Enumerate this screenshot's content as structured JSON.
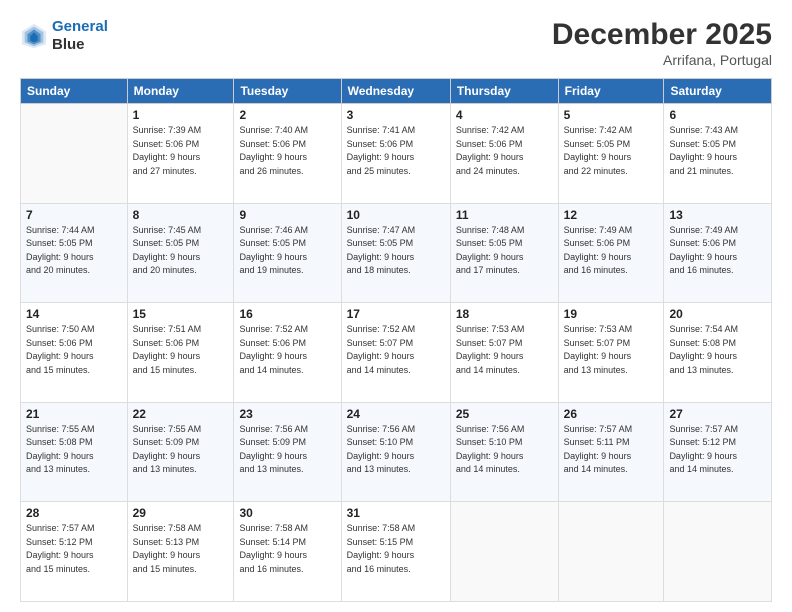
{
  "header": {
    "logo_line1": "General",
    "logo_line2": "Blue",
    "month": "December 2025",
    "location": "Arrifana, Portugal"
  },
  "weekdays": [
    "Sunday",
    "Monday",
    "Tuesday",
    "Wednesday",
    "Thursday",
    "Friday",
    "Saturday"
  ],
  "weeks": [
    [
      {
        "day": "",
        "sunrise": "",
        "sunset": "",
        "daylight": ""
      },
      {
        "day": "1",
        "sunrise": "Sunrise: 7:39 AM",
        "sunset": "Sunset: 5:06 PM",
        "daylight": "Daylight: 9 hours and 27 minutes."
      },
      {
        "day": "2",
        "sunrise": "Sunrise: 7:40 AM",
        "sunset": "Sunset: 5:06 PM",
        "daylight": "Daylight: 9 hours and 26 minutes."
      },
      {
        "day": "3",
        "sunrise": "Sunrise: 7:41 AM",
        "sunset": "Sunset: 5:06 PM",
        "daylight": "Daylight: 9 hours and 25 minutes."
      },
      {
        "day": "4",
        "sunrise": "Sunrise: 7:42 AM",
        "sunset": "Sunset: 5:06 PM",
        "daylight": "Daylight: 9 hours and 24 minutes."
      },
      {
        "day": "5",
        "sunrise": "Sunrise: 7:42 AM",
        "sunset": "Sunset: 5:05 PM",
        "daylight": "Daylight: 9 hours and 22 minutes."
      },
      {
        "day": "6",
        "sunrise": "Sunrise: 7:43 AM",
        "sunset": "Sunset: 5:05 PM",
        "daylight": "Daylight: 9 hours and 21 minutes."
      }
    ],
    [
      {
        "day": "7",
        "sunrise": "Sunrise: 7:44 AM",
        "sunset": "Sunset: 5:05 PM",
        "daylight": "Daylight: 9 hours and 20 minutes."
      },
      {
        "day": "8",
        "sunrise": "Sunrise: 7:45 AM",
        "sunset": "Sunset: 5:05 PM",
        "daylight": "Daylight: 9 hours and 20 minutes."
      },
      {
        "day": "9",
        "sunrise": "Sunrise: 7:46 AM",
        "sunset": "Sunset: 5:05 PM",
        "daylight": "Daylight: 9 hours and 19 minutes."
      },
      {
        "day": "10",
        "sunrise": "Sunrise: 7:47 AM",
        "sunset": "Sunset: 5:05 PM",
        "daylight": "Daylight: 9 hours and 18 minutes."
      },
      {
        "day": "11",
        "sunrise": "Sunrise: 7:48 AM",
        "sunset": "Sunset: 5:05 PM",
        "daylight": "Daylight: 9 hours and 17 minutes."
      },
      {
        "day": "12",
        "sunrise": "Sunrise: 7:49 AM",
        "sunset": "Sunset: 5:06 PM",
        "daylight": "Daylight: 9 hours and 16 minutes."
      },
      {
        "day": "13",
        "sunrise": "Sunrise: 7:49 AM",
        "sunset": "Sunset: 5:06 PM",
        "daylight": "Daylight: 9 hours and 16 minutes."
      }
    ],
    [
      {
        "day": "14",
        "sunrise": "Sunrise: 7:50 AM",
        "sunset": "Sunset: 5:06 PM",
        "daylight": "Daylight: 9 hours and 15 minutes."
      },
      {
        "day": "15",
        "sunrise": "Sunrise: 7:51 AM",
        "sunset": "Sunset: 5:06 PM",
        "daylight": "Daylight: 9 hours and 15 minutes."
      },
      {
        "day": "16",
        "sunrise": "Sunrise: 7:52 AM",
        "sunset": "Sunset: 5:06 PM",
        "daylight": "Daylight: 9 hours and 14 minutes."
      },
      {
        "day": "17",
        "sunrise": "Sunrise: 7:52 AM",
        "sunset": "Sunset: 5:07 PM",
        "daylight": "Daylight: 9 hours and 14 minutes."
      },
      {
        "day": "18",
        "sunrise": "Sunrise: 7:53 AM",
        "sunset": "Sunset: 5:07 PM",
        "daylight": "Daylight: 9 hours and 14 minutes."
      },
      {
        "day": "19",
        "sunrise": "Sunrise: 7:53 AM",
        "sunset": "Sunset: 5:07 PM",
        "daylight": "Daylight: 9 hours and 13 minutes."
      },
      {
        "day": "20",
        "sunrise": "Sunrise: 7:54 AM",
        "sunset": "Sunset: 5:08 PM",
        "daylight": "Daylight: 9 hours and 13 minutes."
      }
    ],
    [
      {
        "day": "21",
        "sunrise": "Sunrise: 7:55 AM",
        "sunset": "Sunset: 5:08 PM",
        "daylight": "Daylight: 9 hours and 13 minutes."
      },
      {
        "day": "22",
        "sunrise": "Sunrise: 7:55 AM",
        "sunset": "Sunset: 5:09 PM",
        "daylight": "Daylight: 9 hours and 13 minutes."
      },
      {
        "day": "23",
        "sunrise": "Sunrise: 7:56 AM",
        "sunset": "Sunset: 5:09 PM",
        "daylight": "Daylight: 9 hours and 13 minutes."
      },
      {
        "day": "24",
        "sunrise": "Sunrise: 7:56 AM",
        "sunset": "Sunset: 5:10 PM",
        "daylight": "Daylight: 9 hours and 13 minutes."
      },
      {
        "day": "25",
        "sunrise": "Sunrise: 7:56 AM",
        "sunset": "Sunset: 5:10 PM",
        "daylight": "Daylight: 9 hours and 14 minutes."
      },
      {
        "day": "26",
        "sunrise": "Sunrise: 7:57 AM",
        "sunset": "Sunset: 5:11 PM",
        "daylight": "Daylight: 9 hours and 14 minutes."
      },
      {
        "day": "27",
        "sunrise": "Sunrise: 7:57 AM",
        "sunset": "Sunset: 5:12 PM",
        "daylight": "Daylight: 9 hours and 14 minutes."
      }
    ],
    [
      {
        "day": "28",
        "sunrise": "Sunrise: 7:57 AM",
        "sunset": "Sunset: 5:12 PM",
        "daylight": "Daylight: 9 hours and 15 minutes."
      },
      {
        "day": "29",
        "sunrise": "Sunrise: 7:58 AM",
        "sunset": "Sunset: 5:13 PM",
        "daylight": "Daylight: 9 hours and 15 minutes."
      },
      {
        "day": "30",
        "sunrise": "Sunrise: 7:58 AM",
        "sunset": "Sunset: 5:14 PM",
        "daylight": "Daylight: 9 hours and 16 minutes."
      },
      {
        "day": "31",
        "sunrise": "Sunrise: 7:58 AM",
        "sunset": "Sunset: 5:15 PM",
        "daylight": "Daylight: 9 hours and 16 minutes."
      },
      {
        "day": "",
        "sunrise": "",
        "sunset": "",
        "daylight": ""
      },
      {
        "day": "",
        "sunrise": "",
        "sunset": "",
        "daylight": ""
      },
      {
        "day": "",
        "sunrise": "",
        "sunset": "",
        "daylight": ""
      }
    ]
  ]
}
